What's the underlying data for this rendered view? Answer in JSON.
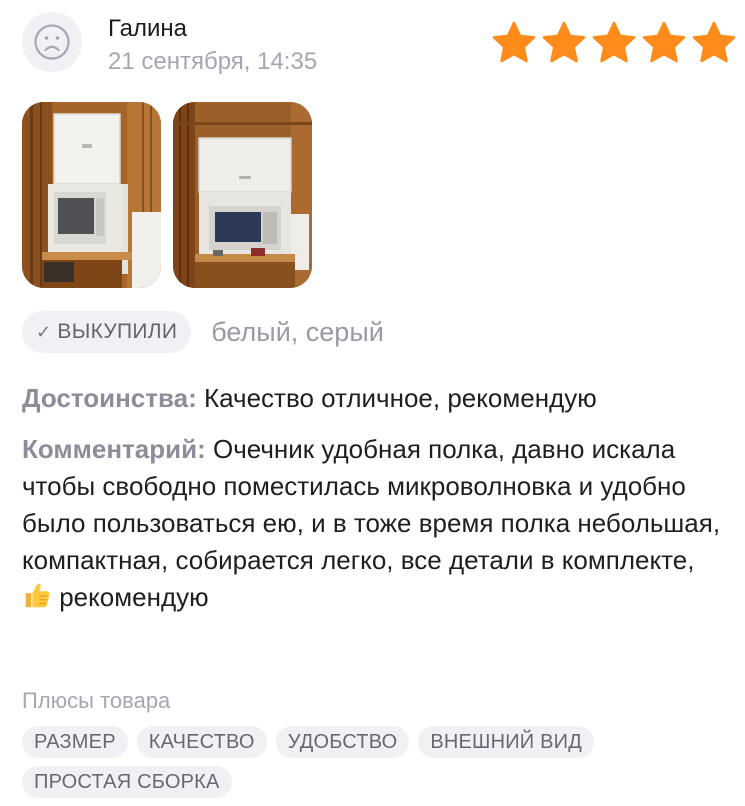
{
  "review": {
    "author": "Галина",
    "date": "21 сентября, 14:35",
    "rating": 5,
    "rating_max": 5,
    "avatar_icon": "sad-face-icon",
    "star_icon": "star-icon",
    "star_color": "#ff8c1a",
    "photos": [
      {
        "name": "photo-microwave-shelf-1"
      },
      {
        "name": "photo-microwave-shelf-2"
      }
    ],
    "bought_badge": {
      "icon": "checkmark-icon",
      "check_glyph": "✓",
      "label": "ВЫКУПИЛИ"
    },
    "variant": "белый, серый",
    "advantages": {
      "label": "Достоинства:",
      "text": " Качество отличное, рекомендую"
    },
    "comment": {
      "label": "Комментарий:",
      "text": " Очечник удобная полка, давно искала чтобы свободно поместилась микроволновка и удобно было пользоваться ею, и в тоже время полка небольшая, компактная, собирается легко, все детали в комплекте,",
      "emoji_icon": "thumbs-up-icon",
      "text_end": " рекомендую"
    },
    "pluses": {
      "title": "Плюсы товара",
      "tags": [
        "РАЗМЕР",
        "КАЧЕСТВО",
        "УДОБСТВО",
        "ВНЕШНИЙ ВИД",
        "ПРОСТАЯ СБОРКА"
      ]
    }
  }
}
